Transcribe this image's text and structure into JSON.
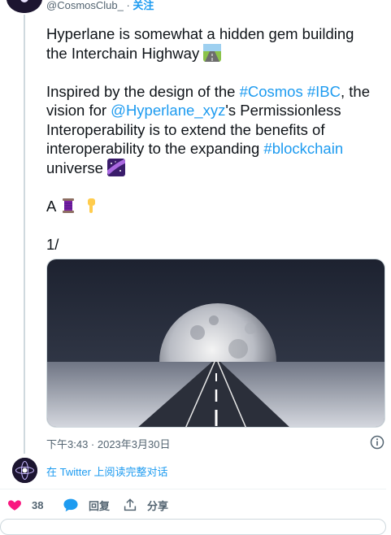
{
  "author": {
    "handle": "@CosmosClub_",
    "separator": " · ",
    "follow_label": "关注"
  },
  "tweet": {
    "line1": "Hyperlane is somewhat a hidden gem building",
    "line2": "the Interchain Highway",
    "para2_pre": "Inspired by the design of the ",
    "hashtag_cosmos": "#Cosmos",
    "space": " ",
    "hashtag_ibc": "#IBC",
    "para2_mid1": ", the",
    "para2_line2_pre": "vision for ",
    "mention": "@Hyperlane_xyz",
    "para2_line2_post": "'s Permissionless",
    "para2_line3": "Interoperability is to extend the benefits of",
    "para2_line4_pre": "interoperability to the expanding ",
    "hashtag_blockchain": "#blockchain",
    "para2_line5": "universe",
    "para3": "A",
    "para4": "1/"
  },
  "meta": {
    "timestamp": "下午3:43 · 2023年3月30日"
  },
  "thread_link": {
    "label": "在 Twitter 上阅读完整对话"
  },
  "actions": {
    "likes": "38",
    "reply_label": "回复",
    "share_label": "分享"
  },
  "colors": {
    "link": "#1d9bf0",
    "like": "#f91880",
    "text": "#0f1419",
    "muted": "#536471"
  },
  "icons": [
    "road-emoji",
    "milky-way-emoji",
    "thread-emoji",
    "pointing-down-emoji",
    "info-icon",
    "heart-icon",
    "reply-icon",
    "share-icon"
  ]
}
